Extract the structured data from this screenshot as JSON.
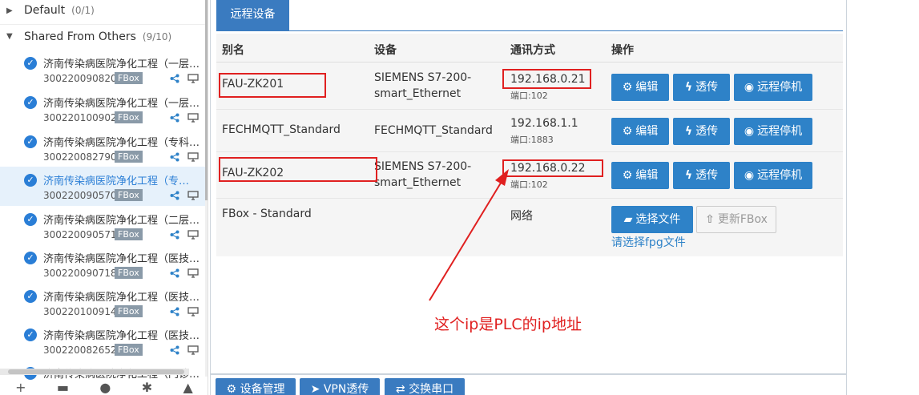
{
  "sidebar": {
    "groups": [
      {
        "label": "Default",
        "count": "(0/1)"
      },
      {
        "label": "Shared From Others",
        "count": "(9/10)"
      }
    ],
    "devices": [
      {
        "name": "济南传染病医院净化工程（一层…",
        "sn": "300220090820",
        "badge": "FBox"
      },
      {
        "name": "济南传染病医院净化工程（一层…",
        "sn": "300220100902",
        "badge": "FBox"
      },
      {
        "name": "济南传染病医院净化工程（专科…",
        "sn": "300220082790",
        "badge": "FBox"
      },
      {
        "name": "济南传染病医院净化工程（专…",
        "sn": "300220090570",
        "badge": "FBox"
      },
      {
        "name": "济南传染病医院净化工程（二层…",
        "sn": "300220090571",
        "badge": "FBox"
      },
      {
        "name": "济南传染病医院净化工程（医技…",
        "sn": "300220090718",
        "badge": "FBox"
      },
      {
        "name": "济南传染病医院净化工程（医技…",
        "sn": "300220100914",
        "badge": "FBox"
      },
      {
        "name": "济南传染病医院净化工程（医技…",
        "sn": "300220082652",
        "badge": "FBox"
      },
      {
        "name": "济南传染病医院净化工程（门诊…",
        "sn": "",
        "badge": ""
      }
    ]
  },
  "tab": {
    "label": "远程设备"
  },
  "table": {
    "headers": [
      "别名",
      "设备",
      "通讯方式",
      "操作"
    ],
    "rows": [
      {
        "alias": "FAU-ZK201",
        "device": "SIEMENS S7-200-smart_Ethernet",
        "ip": "192.168.0.21",
        "port": "端口:102"
      },
      {
        "alias": "FECHMQTT_Standard",
        "device": "FECHMQTT_Standard",
        "ip": "192.168.1.1",
        "port": "端口:1883"
      },
      {
        "alias": "FAU-ZK202",
        "device": "SIEMENS S7-200-smart_Ethernet",
        "ip": "192.168.0.22",
        "port": "端口:102"
      },
      {
        "alias": "FBox - Standard",
        "device": "",
        "ip": "网络",
        "port": ""
      }
    ],
    "buttons": {
      "edit": "编辑",
      "passthrough": "透传",
      "remote_stop": "远程停机",
      "choose_file": "选择文件",
      "update_fbox": "更新FBox"
    },
    "hint": "请选择fpg文件"
  },
  "annotation": "这个ip是PLC的ip地址",
  "bottom_buttons": [
    "设备管理",
    "VPN透传",
    "交换串口"
  ],
  "colors": {
    "accent": "#2e82c8",
    "annotation": "#e02020"
  }
}
